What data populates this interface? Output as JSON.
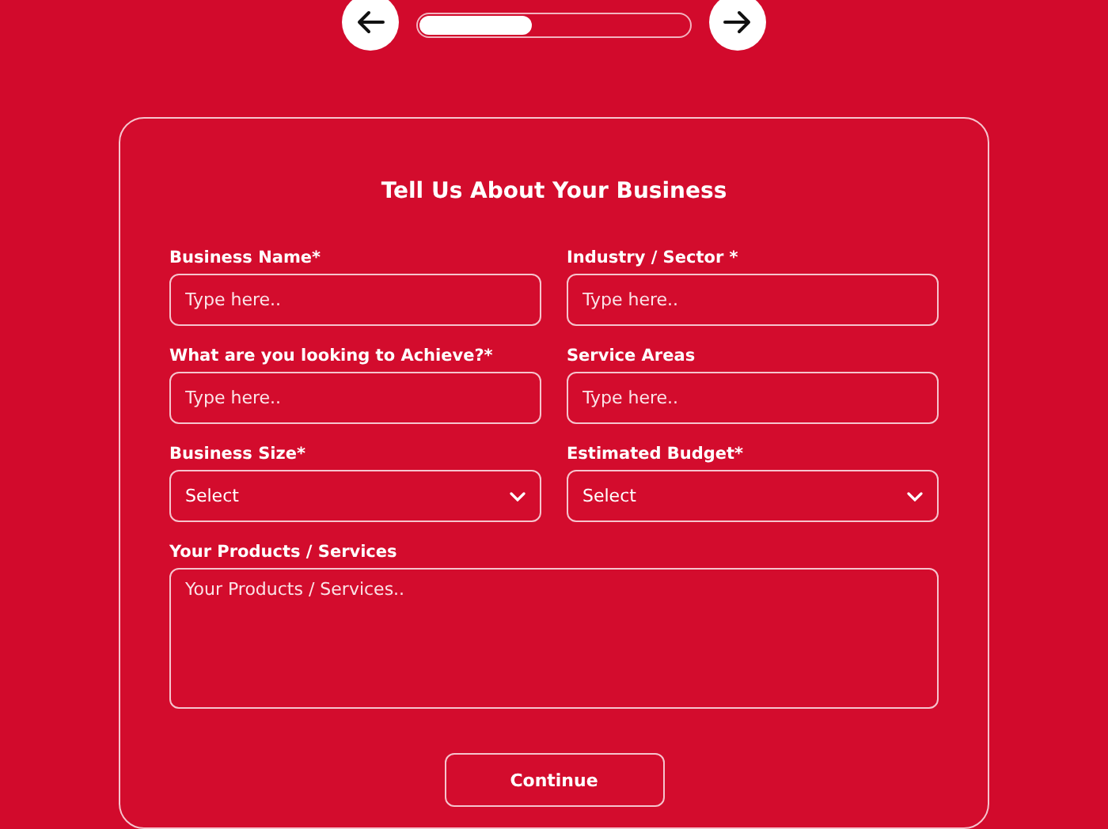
{
  "progress": {
    "level": 0.42
  },
  "form": {
    "title": "Tell Us About Your Business",
    "fields": [
      {
        "kind": "text",
        "label": "Business Name*",
        "placeholder": "Type here.."
      },
      {
        "kind": "text",
        "label": "Industry / Sector *",
        "placeholder": "Type here.."
      },
      {
        "kind": "text",
        "label": "What are you looking to Achieve?*",
        "placeholder": "Type here.."
      },
      {
        "kind": "text",
        "label": "Service Areas",
        "placeholder": "Type here.."
      },
      {
        "kind": "select",
        "label": "Business Size*",
        "value": "Select"
      },
      {
        "kind": "select",
        "label": "Estimated Budget*",
        "value": "Select"
      },
      {
        "kind": "textarea",
        "label": "Your Products / Services",
        "placeholder": "Your Products / Services.."
      }
    ],
    "submit": "Continue"
  }
}
